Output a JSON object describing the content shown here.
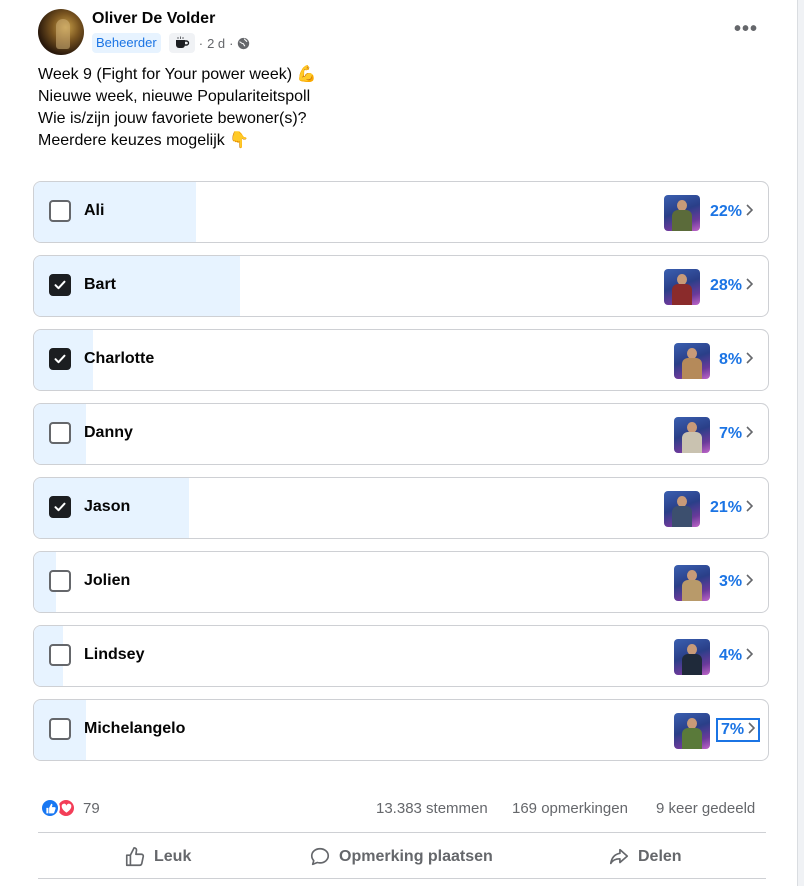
{
  "post": {
    "author": "Oliver De Volder",
    "role_badge": "Beheerder",
    "time": "2 d",
    "separator": "·",
    "more_icon": "more-horizontal-icon",
    "lines": [
      "Week 9 (Fight for Your power week) 💪",
      "Nieuwe week, nieuwe Populariteitspoll",
      "Wie is/zijn jouw favoriete bewoner(s)?",
      "Meerdere keuzes mogelijk 👇"
    ]
  },
  "poll": {
    "options": [
      {
        "label": "Ali",
        "percent_text": "22%",
        "percent": 22,
        "checked": false
      },
      {
        "label": "Bart",
        "percent_text": "28%",
        "percent": 28,
        "checked": true
      },
      {
        "label": "Charlotte",
        "percent_text": "8%",
        "percent": 8,
        "checked": true
      },
      {
        "label": "Danny",
        "percent_text": "7%",
        "percent": 7,
        "checked": false
      },
      {
        "label": "Jason",
        "percent_text": "21%",
        "percent": 21,
        "checked": true
      },
      {
        "label": "Jolien",
        "percent_text": "3%",
        "percent": 3,
        "checked": false
      },
      {
        "label": "Lindsey",
        "percent_text": "4%",
        "percent": 4,
        "checked": false
      },
      {
        "label": "Michelangelo",
        "percent_text": "7%",
        "percent": 7,
        "checked": false
      }
    ]
  },
  "footer": {
    "reaction_count": "79",
    "votes": "13.383 stemmen",
    "comments": "169 opmerkingen",
    "shares": "9 keer gedeeld",
    "like_label": "Leuk",
    "comment_label": "Opmerking plaatsen",
    "share_label": "Delen"
  },
  "colors": {
    "accent": "#1b74e4",
    "fill": "#e7f3ff",
    "like": "#1877f2",
    "love": "#f33e58"
  }
}
